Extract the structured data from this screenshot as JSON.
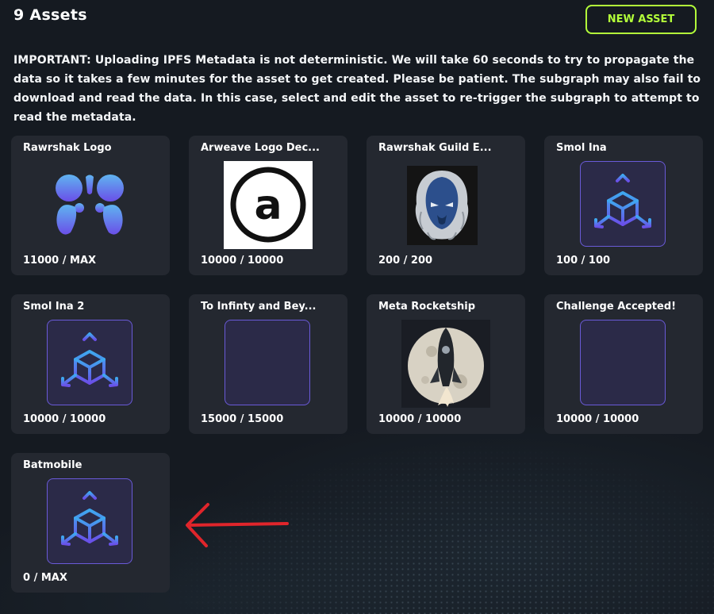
{
  "header": {
    "title": "9 Assets",
    "new_asset_label": "NEW ASSET"
  },
  "notice": "IMPORTANT: Uploading IPFS Metadata is not deterministic. We will take 60 seconds to try to propagate the data so it takes a few minutes for the asset to get created. Please be patient. The subgraph may also fail to download and read the data. In this case, select and edit the asset to re-trigger the subgraph to attempt to read the metadata.",
  "assets": [
    {
      "name": "Rawrshak Logo",
      "supply": "11000 / MAX",
      "icon": "rawrshak-logo-icon"
    },
    {
      "name": "Arweave Logo Dec...",
      "supply": "10000 / 10000",
      "icon": "arweave-logo-icon"
    },
    {
      "name": "Rawrshak Guild E...",
      "supply": "200 / 200",
      "icon": "lion-emblem-icon"
    },
    {
      "name": "Smol Ina",
      "supply": "100 / 100",
      "icon": "3d-asset-icon"
    },
    {
      "name": "Smol Ina 2",
      "supply": "10000 / 10000",
      "icon": "3d-asset-icon"
    },
    {
      "name": "To Infinty and Bey...",
      "supply": "15000 / 15000",
      "icon": "audio-waveform-icon"
    },
    {
      "name": "Meta Rocketship",
      "supply": "10000 / 10000",
      "icon": "rocket-moon-icon"
    },
    {
      "name": "Challenge Accepted!",
      "supply": "10000 / 10000",
      "icon": "audio-waveform-icon"
    },
    {
      "name": "Batmobile",
      "supply": "0 / MAX",
      "icon": "3d-asset-icon"
    }
  ],
  "annotation": {
    "icon": "red-arrow-icon",
    "color": "#e0252b"
  },
  "colors": {
    "background": "#151a21",
    "card": "#242830",
    "accent": "#b3ff3a",
    "tile_border": "#6a5ad8"
  }
}
